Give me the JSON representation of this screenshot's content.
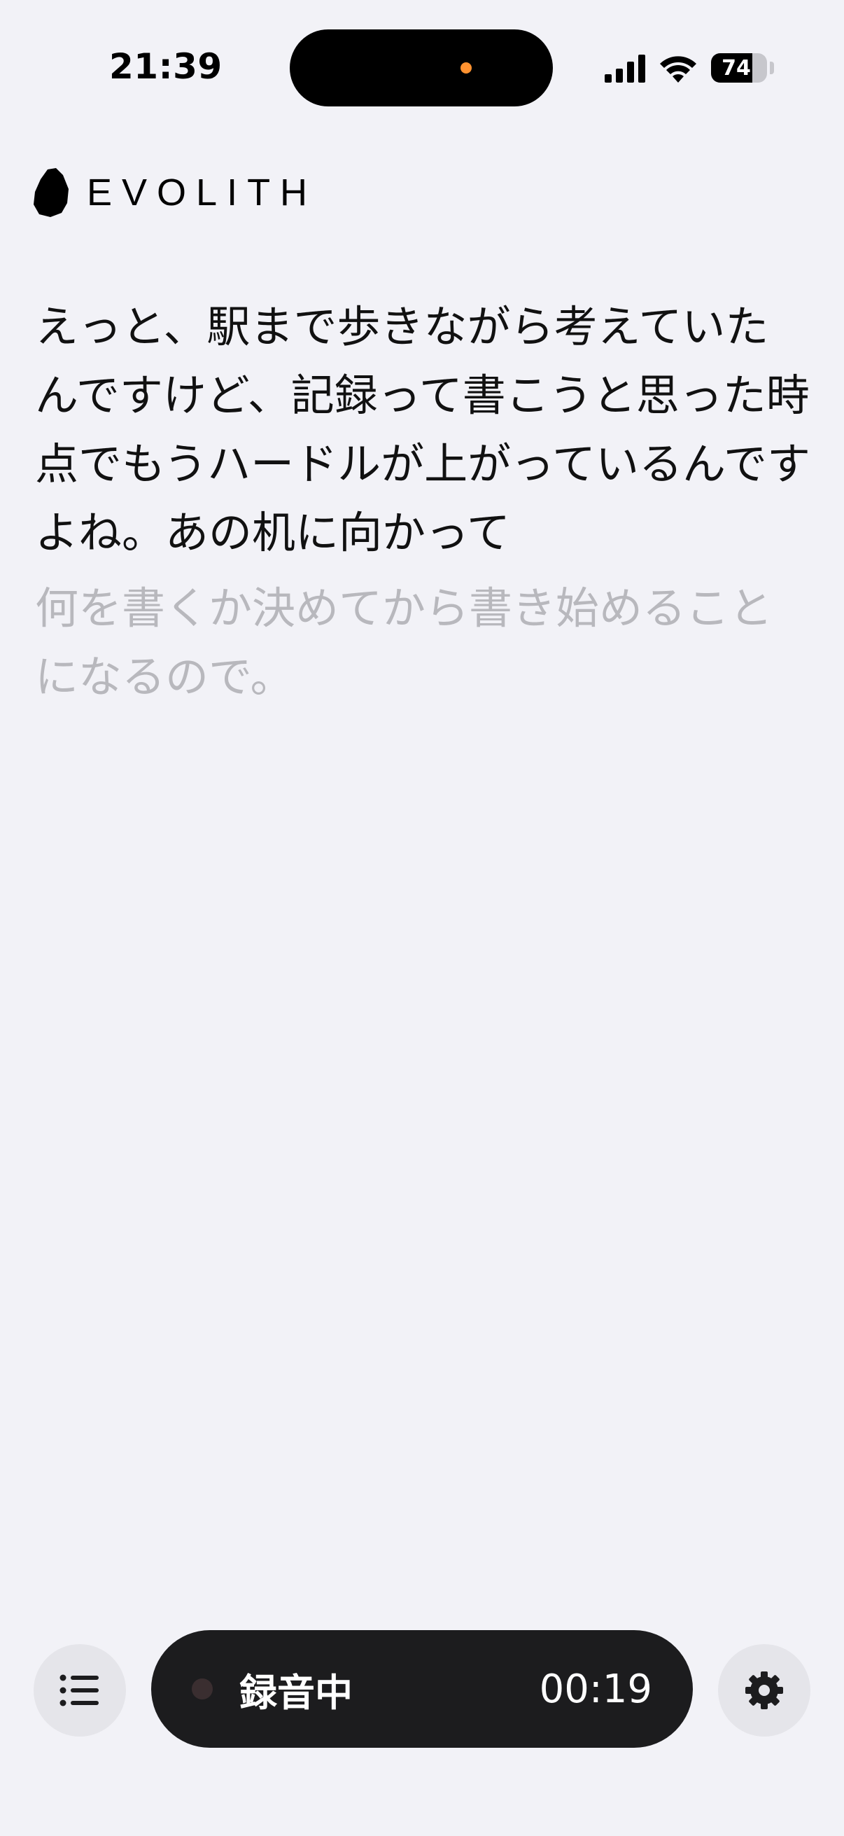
{
  "status_bar": {
    "time": "21:39",
    "battery": "74",
    "battery_level": 0.74,
    "mic_indicator_color": "#ff9230"
  },
  "brand": {
    "name": "EVOLITH",
    "logo_icon": "stone-logo-icon"
  },
  "transcript": {
    "final_text": "えっと、駅まで歩きながら考えていたんですけど、記録って書こうと思った時点でもうハードルが上がっているんですよね。あの机に向かって",
    "interim_text": "何を書くか決めてから書き始めることになるので。"
  },
  "controls": {
    "list_icon": "list-icon",
    "settings_icon": "gear-icon",
    "recording_label": "録音中",
    "recording_time": "00:19"
  },
  "colors": {
    "background": "#f2f2f7",
    "pill": "#1c1c1e",
    "interim_text": "#b8b8bd",
    "round_button": "#e5e5ea"
  }
}
